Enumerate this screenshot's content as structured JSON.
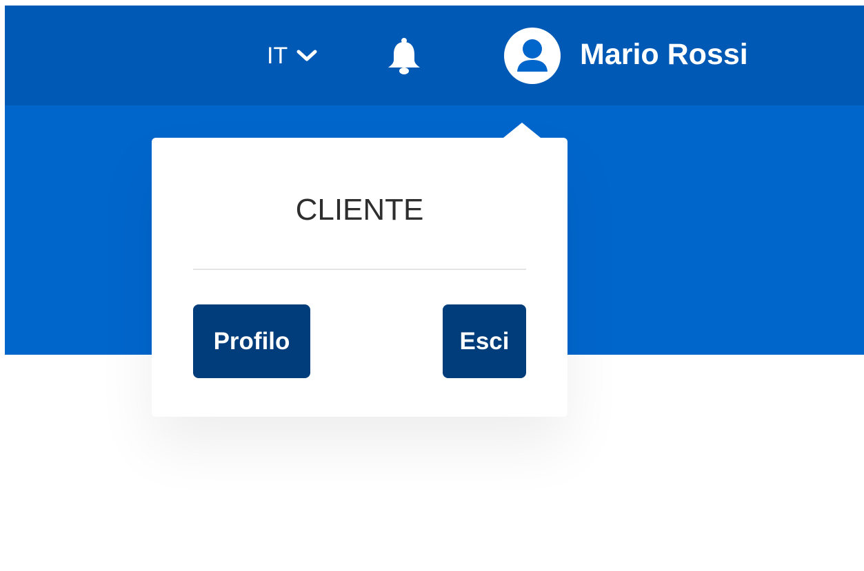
{
  "header": {
    "language": {
      "label": "IT",
      "icon": "chevron-down-icon"
    },
    "notifications": {
      "icon": "bell-icon"
    },
    "user": {
      "name": "Mario Rossi",
      "icon": "user-avatar-icon"
    }
  },
  "user_menu": {
    "role": "CLIENTE",
    "profile_label": "Profilo",
    "logout_label": "Esci"
  },
  "colors": {
    "header_background": "#0059b5",
    "hero_background": "#0066cc",
    "button_background": "#003d7a",
    "text_light": "#ffffff",
    "text_dark": "#2e2e2e"
  }
}
